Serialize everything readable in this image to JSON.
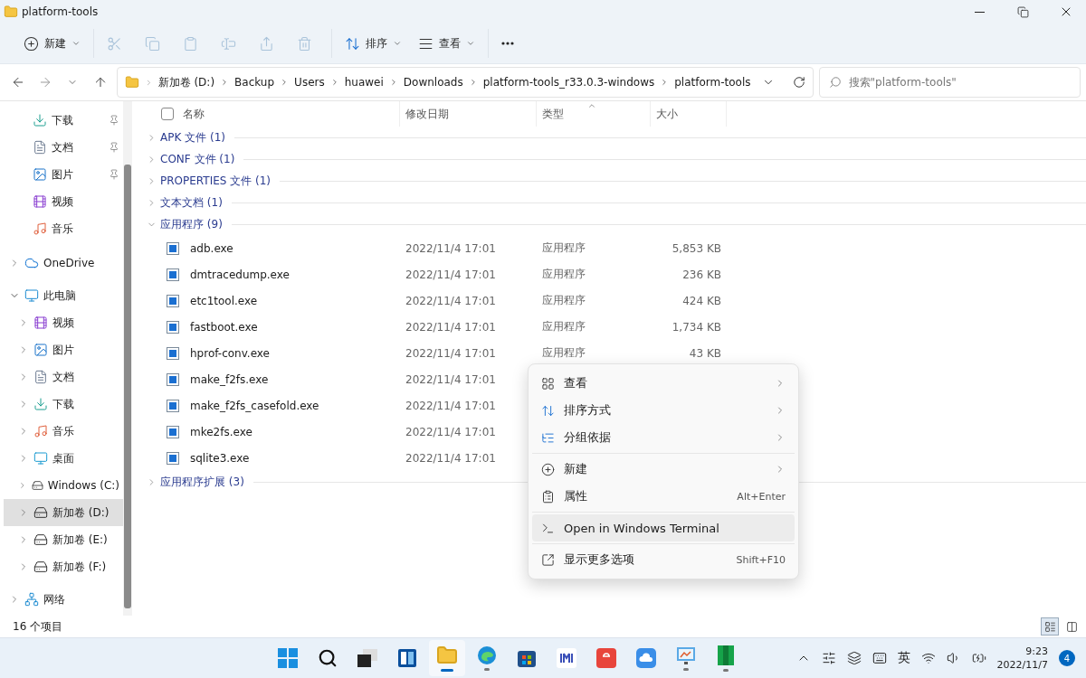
{
  "window": {
    "title": "platform-tools"
  },
  "toolbar": {
    "groups": [
      {
        "buttons": [
          {
            "kind": "new",
            "label": "新建",
            "dropdown": true,
            "disabled": false
          }
        ]
      },
      {
        "buttons": [
          {
            "kind": "cut",
            "disabled": true
          },
          {
            "kind": "copy",
            "disabled": true
          },
          {
            "kind": "paste",
            "disabled": true
          },
          {
            "kind": "rename",
            "disabled": true
          },
          {
            "kind": "share",
            "disabled": true
          },
          {
            "kind": "delete",
            "disabled": true
          }
        ]
      },
      {
        "buttons": [
          {
            "kind": "sort",
            "label": "排序",
            "dropdown": true,
            "disabled": false
          },
          {
            "kind": "view",
            "label": "查看",
            "dropdown": true,
            "disabled": false
          }
        ]
      },
      {
        "buttons": [
          {
            "kind": "more",
            "disabled": false
          }
        ]
      }
    ]
  },
  "address": {
    "path": [
      "新加卷 (D:)",
      "Backup",
      "Users",
      "huawei",
      "Downloads",
      "platform-tools_r33.0.3-windows",
      "platform-tools"
    ]
  },
  "search": {
    "placeholder": "搜索\"platform-tools\""
  },
  "sidebar": {
    "items": [
      {
        "label": "下载",
        "kind": "download",
        "pinned": true
      },
      {
        "label": "文档",
        "kind": "document",
        "pinned": true
      },
      {
        "label": "图片",
        "kind": "picture",
        "pinned": true
      },
      {
        "label": "视频",
        "kind": "video",
        "pinned": false
      },
      {
        "label": "音乐",
        "kind": "music",
        "pinned": false
      },
      {
        "label": "OneDrive",
        "kind": "cloud",
        "expanded": false,
        "selected": false
      },
      {
        "label": "此电脑",
        "kind": "pc",
        "expanded": true,
        "selected": false,
        "children": [
          {
            "label": "视频",
            "kind": "video",
            "expanded": false,
            "selected": false
          },
          {
            "label": "图片",
            "kind": "picture",
            "expanded": false,
            "selected": false
          },
          {
            "label": "文档",
            "kind": "document",
            "expanded": false,
            "selected": false
          },
          {
            "label": "下载",
            "kind": "download",
            "expanded": false,
            "selected": false
          },
          {
            "label": "音乐",
            "kind": "music",
            "expanded": false,
            "selected": false
          },
          {
            "label": "桌面",
            "kind": "desktop",
            "expanded": false,
            "selected": false
          },
          {
            "label": "Windows (C:)",
            "kind": "system-drive",
            "expanded": false,
            "selected": false
          },
          {
            "label": "新加卷 (D:)",
            "kind": "drive",
            "expanded": false,
            "selected": true
          },
          {
            "label": "新加卷 (E:)",
            "kind": "drive",
            "expanded": false,
            "selected": false
          },
          {
            "label": "新加卷 (F:)",
            "kind": "drive",
            "expanded": false,
            "selected": false
          }
        ]
      },
      {
        "label": "网络",
        "kind": "network",
        "expanded": false,
        "selected": false
      }
    ]
  },
  "table": {
    "select_all_checked": false,
    "columns": [
      "名称",
      "修改日期",
      "类型",
      "大小"
    ],
    "groups": [
      {
        "label": "APK 文件 (1)",
        "expanded": false
      },
      {
        "label": "CONF 文件 (1)",
        "expanded": false
      },
      {
        "label": "PROPERTIES 文件 (1)",
        "expanded": false
      },
      {
        "label": "文本文档 (1)",
        "expanded": false
      },
      {
        "label": "应用程序 (9)",
        "expanded": true,
        "rows": [
          {
            "name": "adb.exe",
            "date": "2022/11/4 17:01",
            "type": "应用程序",
            "size": "5,853 KB"
          },
          {
            "name": "dmtracedump.exe",
            "date": "2022/11/4 17:01",
            "type": "应用程序",
            "size": "236 KB"
          },
          {
            "name": "etc1tool.exe",
            "date": "2022/11/4 17:01",
            "type": "应用程序",
            "size": "424 KB"
          },
          {
            "name": "fastboot.exe",
            "date": "2022/11/4 17:01",
            "type": "应用程序",
            "size": "1,734 KB"
          },
          {
            "name": "hprof-conv.exe",
            "date": "2022/11/4 17:01",
            "type": "应用程序",
            "size": "43 KB"
          },
          {
            "name": "make_f2fs.exe",
            "date": "2022/11/4 17:01"
          },
          {
            "name": "make_f2fs_casefold.exe",
            "date": "2022/11/4 17:01"
          },
          {
            "name": "mke2fs.exe",
            "date": "2022/11/4 17:01"
          },
          {
            "name": "sqlite3.exe",
            "date": "2022/11/4 17:01"
          }
        ]
      },
      {
        "label": "应用程序扩展 (3)",
        "expanded": false
      }
    ]
  },
  "context_menu": {
    "groups": [
      {
        "items": [
          {
            "kind": "view",
            "label": "查看",
            "submenu": true,
            "selected": false
          },
          {
            "kind": "sort",
            "label": "排序方式",
            "submenu": true,
            "selected": false
          },
          {
            "kind": "group",
            "label": "分组依据",
            "submenu": true,
            "selected": false
          }
        ]
      },
      {
        "items": [
          {
            "kind": "new",
            "label": "新建",
            "submenu": true,
            "selected": false
          },
          {
            "kind": "properties",
            "label": "属性",
            "shortcut": "Alt+Enter",
            "selected": false
          }
        ]
      },
      {
        "items": [
          {
            "kind": "terminal",
            "label": "Open in Windows Terminal",
            "selected": true
          }
        ]
      },
      {
        "items": [
          {
            "kind": "more",
            "label": "显示更多选项",
            "shortcut": "Shift+F10",
            "selected": false
          }
        ]
      }
    ]
  },
  "status_bar": {
    "text": "16 个项目",
    "views": [
      {
        "kind": "details",
        "selected": true
      },
      {
        "kind": "tiles",
        "selected": false
      }
    ]
  },
  "taskbar": {
    "apps": [
      {
        "kind": "start",
        "running": false,
        "active": false
      },
      {
        "kind": "search",
        "running": false,
        "active": false
      },
      {
        "kind": "taskview",
        "running": false,
        "active": false
      },
      {
        "kind": "widgets",
        "running": false,
        "active": false
      },
      {
        "kind": "explorer",
        "running": true,
        "active": true
      },
      {
        "kind": "edge",
        "running": true,
        "active": false
      },
      {
        "kind": "store",
        "running": false,
        "active": false
      },
      {
        "kind": "imi",
        "running": false,
        "active": false
      },
      {
        "kind": "shop",
        "running": false,
        "active": false
      },
      {
        "kind": "cloud",
        "running": false,
        "active": false
      },
      {
        "kind": "whiteboard",
        "running": true,
        "active": false
      },
      {
        "kind": "book",
        "running": true,
        "active": false
      }
    ],
    "tray": {
      "input_method": "英",
      "time": "9:23",
      "date": "2022/11/7",
      "notifications": "4"
    }
  }
}
